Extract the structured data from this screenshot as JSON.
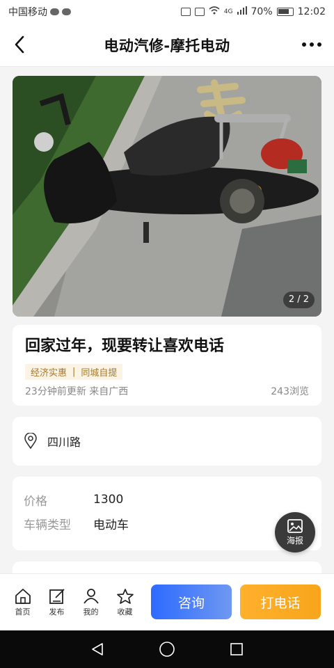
{
  "status_bar": {
    "carrier": "中国移动",
    "network": "4G",
    "battery": "70%",
    "time": "12:02"
  },
  "header": {
    "title": "电动汽修-摩托电动",
    "back_icon": "chevron-left-icon",
    "more_icon": "more-dots-icon"
  },
  "gallery": {
    "counter": "2 / 2"
  },
  "post": {
    "title": "回家过年，现要转让喜欢电话",
    "tags": [
      "经济实惠",
      "同城自提"
    ],
    "tag_separator": "|",
    "updated": "23分钟前更新 来自广西",
    "views": "243浏览"
  },
  "location": {
    "icon": "location-pin-icon",
    "text": "四川路"
  },
  "details": {
    "rows": [
      {
        "label": "价格",
        "value": "1300"
      },
      {
        "label": "车辆类型",
        "value": "电动车"
      }
    ]
  },
  "poster_button": {
    "icon": "image-icon",
    "label": "海报"
  },
  "bottom_tabs": [
    {
      "label": "首页",
      "icon": "home-icon"
    },
    {
      "label": "发布",
      "icon": "edit-icon"
    },
    {
      "label": "我的",
      "icon": "user-icon"
    },
    {
      "label": "收藏",
      "icon": "star-icon"
    }
  ],
  "actions": {
    "consult": "咨询",
    "call": "打电话"
  },
  "colors": {
    "primary_blue": "#2d6bff",
    "call_orange": "#ffb02c",
    "tag_bg": "#fbf3e3",
    "tag_text": "#a5782d"
  }
}
